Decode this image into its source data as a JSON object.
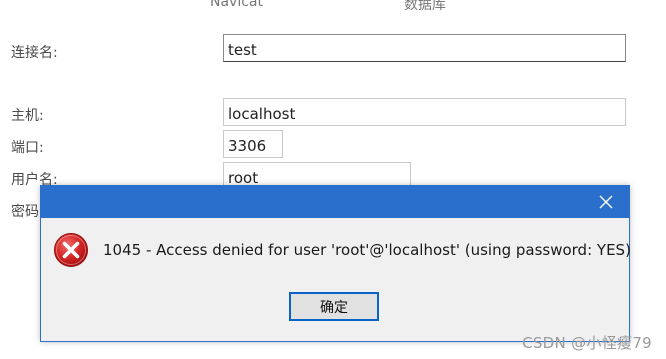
{
  "header": {
    "col1": "Navicat",
    "col2": "数据库"
  },
  "form": {
    "connection_name_label": "连接名:",
    "connection_name_value": "test",
    "host_label": "主机:",
    "host_value": "localhost",
    "port_label": "端口:",
    "port_value": "3306",
    "username_label": "用户名:",
    "username_value": "root",
    "password_label": "密码"
  },
  "dialog": {
    "message": "1045 - Access denied for user 'root'@'localhost' (using password: YES)",
    "ok_label": "确定",
    "icon": "error-icon",
    "titlebar_color": "#2b6fcc"
  },
  "watermark": "CSDN @小怪瘦79"
}
